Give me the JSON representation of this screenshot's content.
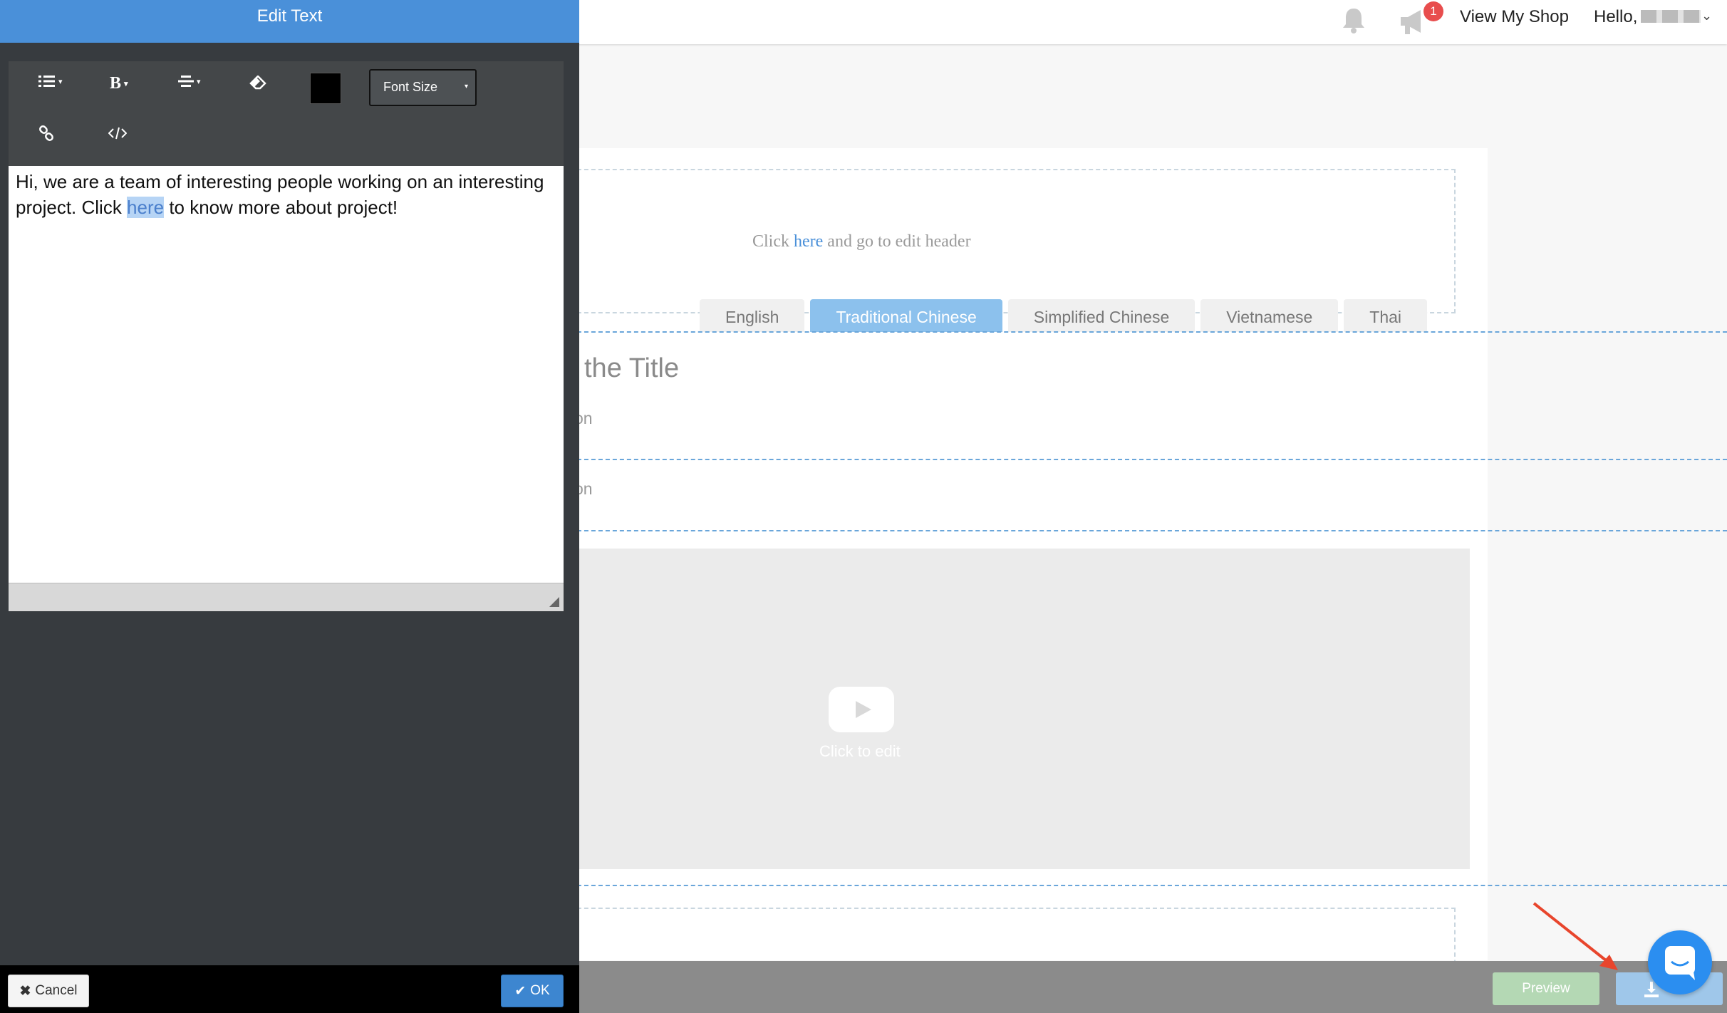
{
  "panel": {
    "title": "Edit Text",
    "toolbar": {
      "font_size_label": "Font Size",
      "color_value": "#000000",
      "icons": [
        "list-icon",
        "bold-icon",
        "align-icon",
        "eraser-icon",
        "link-icon",
        "code-icon"
      ]
    },
    "editor": {
      "text_before": "Hi, we are a team of interesting people working on an interesting project. Click ",
      "selected_text": "here",
      "text_after": " to know more about project!"
    },
    "cancel_label": "Cancel",
    "ok_label": "OK"
  },
  "topbar": {
    "notification_count": "1",
    "view_shop_label": "View My Shop",
    "hello_label": "Hello,"
  },
  "page": {
    "header_hint_prefix": "Click ",
    "header_hint_link": "here",
    "header_hint_suffix": " and go to edit header",
    "languages": [
      "English",
      "Traditional Chinese",
      "Simplified Chinese",
      "Vietnamese",
      "Thai"
    ],
    "active_language": "Traditional Chinese",
    "title_fragment": "the Title",
    "description_fragment_1": "on",
    "description_fragment_2": "on",
    "video_label": "Click to edit"
  },
  "bottombar": {
    "preview_label": "Preview"
  },
  "colors": {
    "accent": "#4a90d9",
    "active_tab": "#8cc1ed",
    "preview_button": "#b4d8b4",
    "chat_bubble": "#2b8ef0",
    "arrow": "#e8452c"
  }
}
